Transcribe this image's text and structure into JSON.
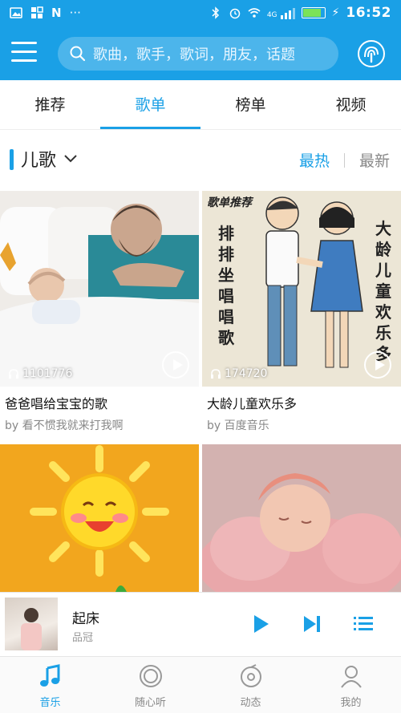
{
  "status_bar": {
    "left_icons": [
      "image-icon",
      "grid-icon",
      "n-icon",
      "more-dots-icon"
    ],
    "right_icons": [
      "bluetooth-icon",
      "alarm-icon",
      "wifi-icon",
      "signal-icon",
      "battery-icon"
    ],
    "more_dots": "···",
    "n_glyph": "N",
    "signal_label": "4G",
    "time": "16:52"
  },
  "header": {
    "search_placeholder": "歌曲，歌手，歌词，朋友，话题"
  },
  "tabs": [
    {
      "label": "推荐",
      "active": false
    },
    {
      "label": "歌单",
      "active": true
    },
    {
      "label": "榜单",
      "active": false
    },
    {
      "label": "视频",
      "active": false
    }
  ],
  "filter": {
    "category": "儿歌",
    "sort_hot": "最热",
    "sort_new": "最新"
  },
  "cards": [
    {
      "title": "爸爸唱给宝宝的歌",
      "author": "by 看不惯我就来打我啊",
      "play_count": "1101776"
    },
    {
      "title": "大龄儿童欢乐多",
      "author": "by 百度音乐",
      "play_count": "174720",
      "cover_badge": "歌单推荐",
      "cover_text_left": "排排坐 唱唱歌",
      "cover_text_right": "大龄儿童欢乐多"
    },
    {
      "title": "",
      "author": "",
      "play_count": ""
    },
    {
      "title": "",
      "author": "",
      "play_count": ""
    }
  ],
  "player": {
    "song": "起床",
    "artist": "品冠"
  },
  "bottom_nav": [
    {
      "label": "音乐",
      "active": true,
      "icon": "music-note-icon"
    },
    {
      "label": "随心听",
      "active": false,
      "icon": "radio-icon"
    },
    {
      "label": "动态",
      "active": false,
      "icon": "feed-icon"
    },
    {
      "label": "我的",
      "active": false,
      "icon": "profile-icon"
    }
  ],
  "colors": {
    "accent": "#1aa0e6",
    "text": "#111111",
    "muted": "#888888"
  }
}
